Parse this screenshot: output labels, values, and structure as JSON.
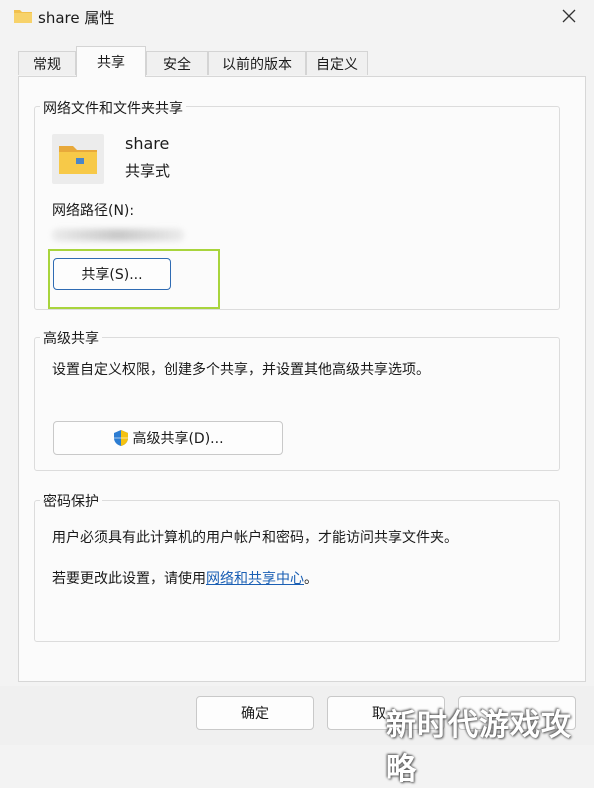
{
  "window": {
    "title": "share 属性"
  },
  "tabs": [
    {
      "label": "常规"
    },
    {
      "label": "共享"
    },
    {
      "label": "安全"
    },
    {
      "label": "以前的版本"
    },
    {
      "label": "自定义"
    }
  ],
  "network_sharing": {
    "group_title": "网络文件和文件夹共享",
    "folder_name": "share",
    "share_status": "共享式",
    "path_label": "网络路径(N):",
    "share_button": "共享(S)..."
  },
  "advanced_sharing": {
    "group_title": "高级共享",
    "description": "设置自定义权限，创建多个共享，并设置其他高级共享选项。",
    "button": "高级共享(D)..."
  },
  "password_protection": {
    "group_title": "密码保护",
    "description": "用户必须具有此计算机的用户帐户和密码，才能访问共享文件夹。",
    "change_prefix": "若要更改此设置，请使用",
    "link_text": "网络和共享中心",
    "change_suffix": "。"
  },
  "footer": {
    "ok_button": "确定",
    "cancel_button": "取"
  },
  "watermark": "新时代游戏攻略",
  "colors": {
    "highlight": "#a8d43c",
    "link": "#1a5fb4"
  }
}
